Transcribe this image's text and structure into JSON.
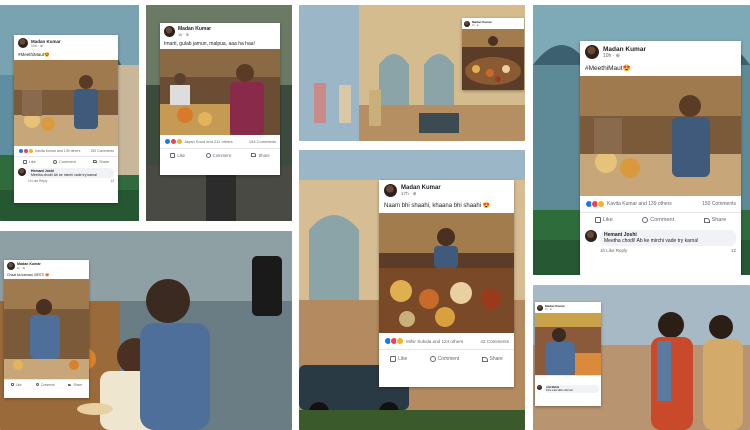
{
  "colors": {
    "facebook_blue": "#1877f2",
    "like_blue": "#1877f2",
    "love_red": "#f33e58",
    "haha_yellow": "#f7b125"
  },
  "p1": {
    "author": "Madan Kumar",
    "time": "10h · ⊕",
    "caption": "#MeethiMaut😍",
    "reactions": "Kavita Kumar and 139 others",
    "comments_count": "150 Comments",
    "like": "Like",
    "comment": "Comment",
    "share": "Share",
    "commenter": "Hemant Joshi",
    "comment_text": "Meetha chodi! Ab ke mirchi vade try karna!",
    "comment_meta": "1h  Like  Reply",
    "comment_count": "12"
  },
  "p2": {
    "author": "Madan Kumar",
    "time": "1h · ⊕",
    "caption": "Imarti, gulab jamun, malpua, aaa ha haa!",
    "reactions": "Jayan Sood and 211 others",
    "comments_count": "154 Comments",
    "like": "Like",
    "comment": "Comment",
    "share": "Share"
  },
  "p3": {
    "author": "Madan Kumar",
    "time": "1h · ⊕",
    "caption": ""
  },
  "p4": {
    "author": "Madan Kumar",
    "time": "10h · ⊕",
    "caption": "#MeethiMaut😍",
    "reactions": "Kavita Kumar and 139 others",
    "comments_count": "150 Comments",
    "like": "Like",
    "comment": "Comment",
    "share": "Share",
    "commenter": "Hemant Joshi",
    "comment_text": "Meetha chodi! Ab ke mirchi vade try karna!",
    "comment_meta": "1h  Like  Reply",
    "comment_count": "12"
  },
  "p5": {
    "author": "Madan Kumar",
    "time": "1h · ⊕",
    "caption": "Chaat ka kamaal, BEST! 😍",
    "like": "Like",
    "comment": "Comment",
    "share": "Share"
  },
  "p6": {
    "author": "Madan Kumar",
    "time": "17h · ⊕",
    "caption": "Naam bhi shaahi, khaana bhi shaahi 😍",
    "reactions": "Mihir Sukala and 124 others",
    "comments_count": "42 Comments",
    "like": "Like",
    "comment": "Comment",
    "share": "Share"
  },
  "p7": {
    "author": "Madan Kumar",
    "time": "1h · ⊕",
    "caption": "",
    "commenter": "Anil Mehta",
    "comment_text": "Kitni mast dikh rahi hai!"
  }
}
